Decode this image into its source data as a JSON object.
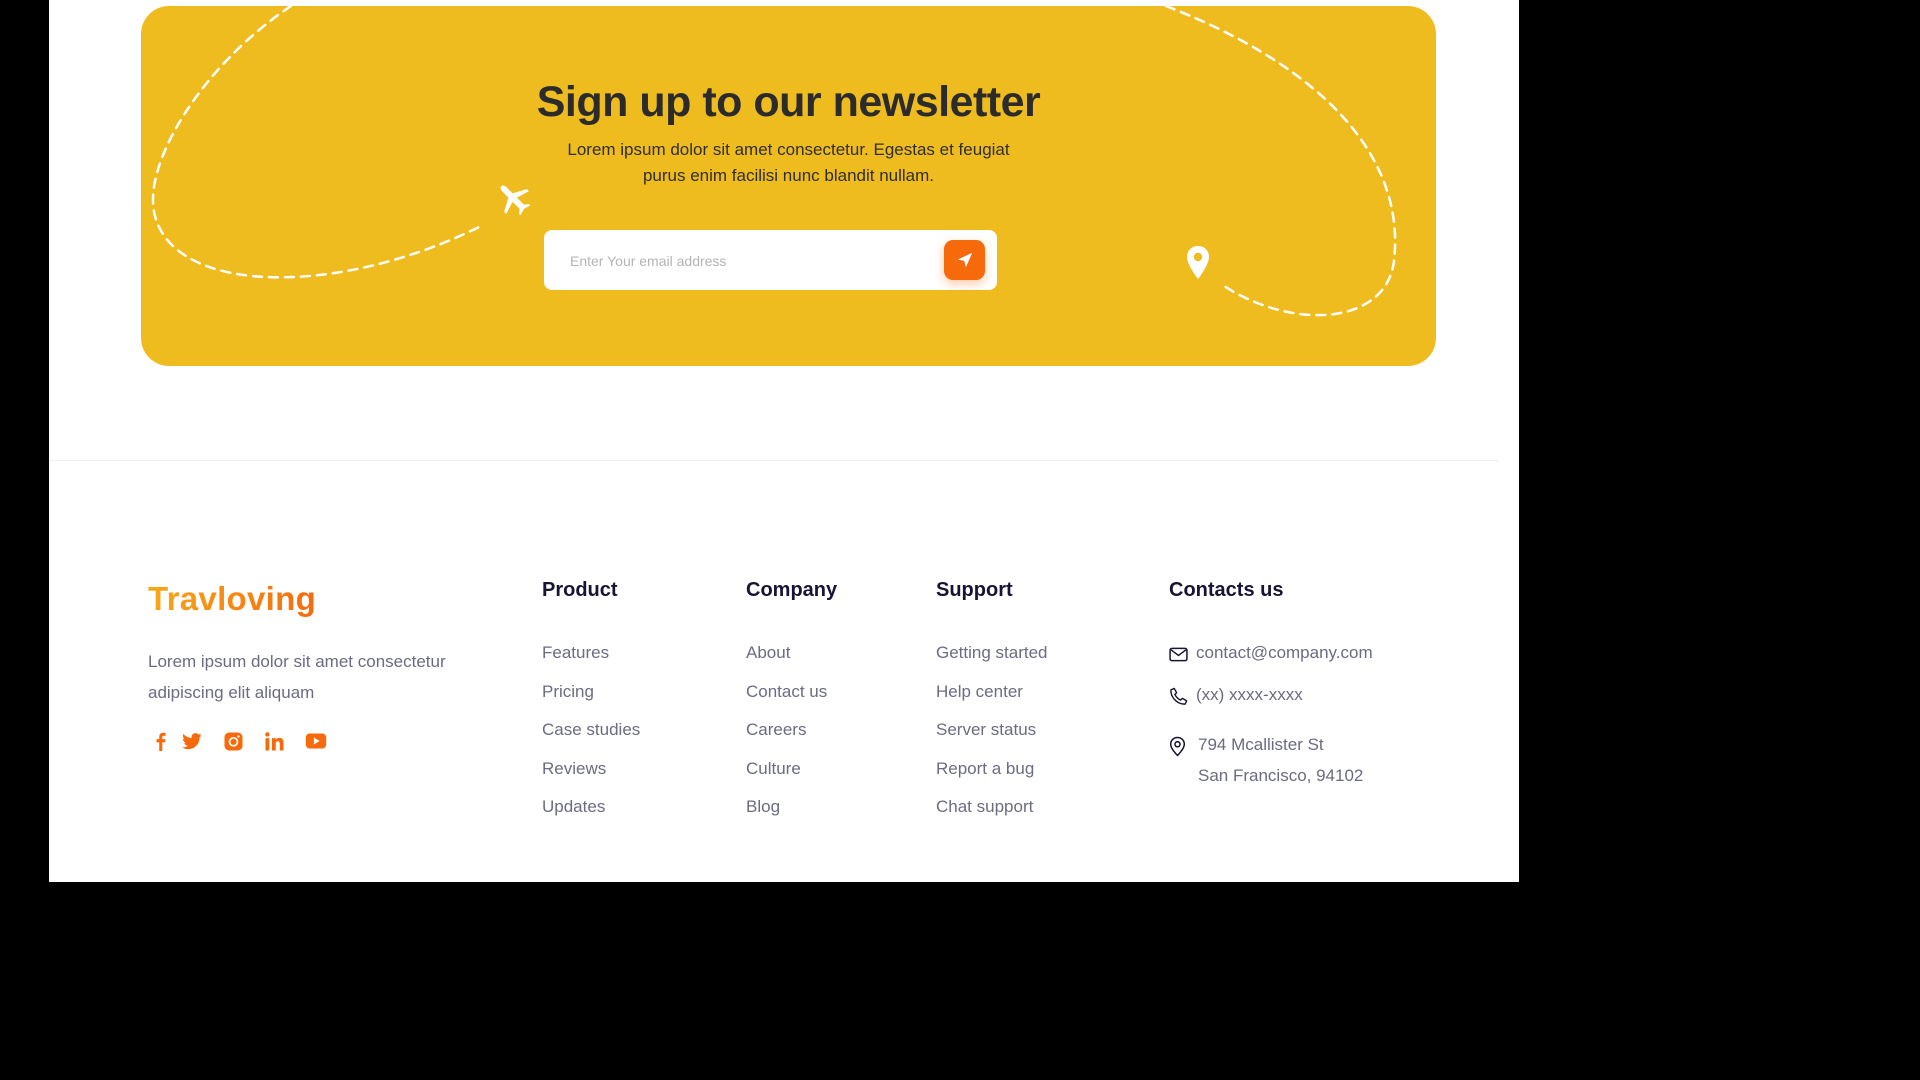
{
  "newsletter": {
    "title": "Sign up to our newsletter",
    "description": "Lorem ipsum dolor sit amet consectetur. Egestas et feugiat purus enim facilisi nunc blandit nullam.",
    "email_placeholder": "Enter Your email address",
    "send_icon": "paper-plane-icon",
    "background_color": "#efbc20",
    "button_color": "#f76a0c"
  },
  "footer": {
    "brand": "Travloving",
    "brand_description": "Lorem ipsum dolor sit amet consectetur adipiscing elit aliquam",
    "socials": [
      "facebook-icon",
      "twitter-icon",
      "instagram-icon",
      "linkedin-icon",
      "youtube-icon"
    ],
    "columns": [
      {
        "title": "Product",
        "items": [
          "Features",
          "Pricing",
          "Case studies",
          "Reviews",
          "Updates"
        ]
      },
      {
        "title": "Company",
        "items": [
          "About",
          "Contact us",
          "Careers",
          "Culture",
          "Blog"
        ]
      },
      {
        "title": "Support",
        "items": [
          "Getting started",
          "Help center",
          "Server status",
          "Report a bug",
          "Chat support"
        ]
      }
    ],
    "contacts": {
      "title": "Contacts us",
      "email": "contact@company.com",
      "phone": "(xx) xxxx-xxxx",
      "address_line1": "794 Mcallister St",
      "address_line2": "San Francisco, 94102"
    },
    "accent_color": "#f76a0c",
    "heading_color": "#181433",
    "text_color": "#6b6b82"
  }
}
